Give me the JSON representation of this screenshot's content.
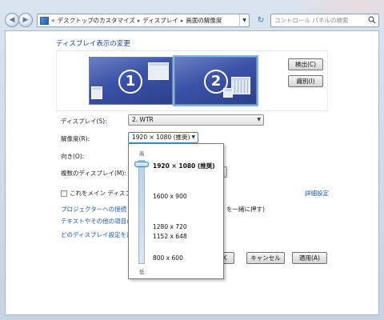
{
  "breadcrumb": {
    "overflow": "«",
    "items": [
      "デスクトップのカスタマイズ",
      "ディスプレイ",
      "画面の解像度"
    ]
  },
  "search": {
    "placeholder": "コントロール パネルの検索"
  },
  "page": {
    "title": "ディスプレイ表示の変更"
  },
  "monitors": [
    {
      "number": "1",
      "selected": false
    },
    {
      "number": "2",
      "selected": true
    }
  ],
  "buttons": {
    "detect": "検出(C)",
    "identify": "識別(I)",
    "ok": "OK",
    "cancel": "キャンセル",
    "apply": "適用(A)"
  },
  "fields": {
    "display_label": "ディスプレイ(S):",
    "display_value": "2. WTR",
    "resolution_label": "解像度(R):",
    "resolution_value": "1920 × 1080 (推奨)",
    "orientation_label": "向き(O):",
    "multi_label": "複数のディスプレイ(M):"
  },
  "checkbox": {
    "label": "これをメイン ディスプ",
    "checked": false
  },
  "links": {
    "advanced": "詳細設定",
    "projector": "プロジェクターへの接続 (",
    "projector_tail": "を一緒に押す)",
    "text_size": "テキストやその他の項目の",
    "which_display": "どのディスプレイ設定を選"
  },
  "resolution_popup": {
    "high": "高",
    "low": "低",
    "slider_level": 1.0,
    "options": [
      "1920 × 1080 (推奨)",
      "1600 x 900",
      "1280 x 720",
      "1152 x 648",
      "800 x 600"
    ]
  },
  "colors": {
    "link": "#1e5aa6",
    "title": "#1e3c96",
    "monitor": "#3b52a6",
    "selection_outline": "#7fb7e8"
  }
}
